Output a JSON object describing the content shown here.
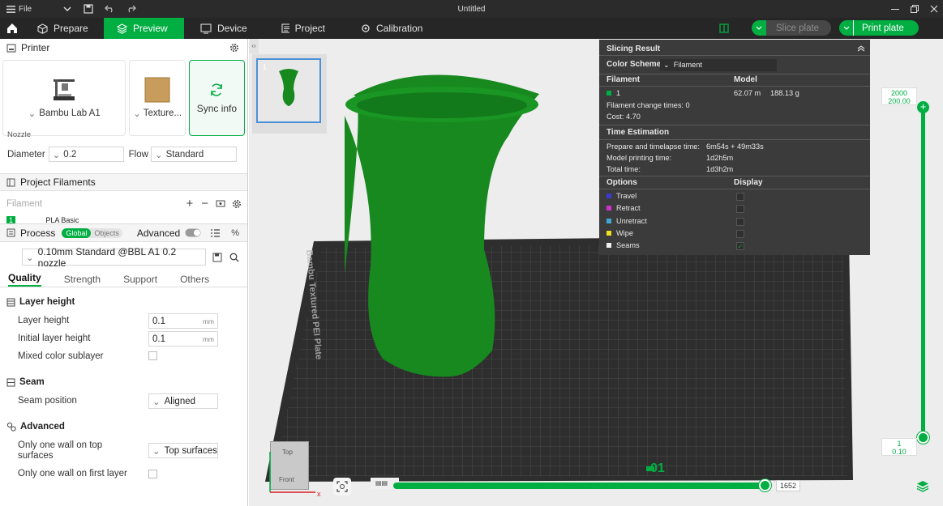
{
  "titlebar": {
    "file_label": "File",
    "title": "Untitled"
  },
  "tabs": [
    {
      "label": "Prepare",
      "icon": "cube-icon"
    },
    {
      "label": "Preview",
      "icon": "layers-icon",
      "active": true
    },
    {
      "label": "Device",
      "icon": "device-icon"
    },
    {
      "label": "Project",
      "icon": "project-icon"
    },
    {
      "label": "Calibration",
      "icon": "calibration-icon"
    }
  ],
  "actions": {
    "slice_label": "Slice plate",
    "print_label": "Print plate"
  },
  "printer": {
    "section_title": "Printer",
    "printer_name": "Bambu Lab A1",
    "plate_type": "Texture...",
    "sync_label": "Sync info",
    "nozzle_label": "Nozzle",
    "diameter_label": "Diameter",
    "diameter_value": "0.2",
    "flow_label": "Flow",
    "flow_value": "Standard"
  },
  "filaments": {
    "section_title": "Project Filaments",
    "placeholder": "Filament",
    "first_item": "PLA Basic",
    "first_index": "1"
  },
  "process": {
    "section_title": "Process",
    "global_label": "Global",
    "objects_label": "Objects",
    "advanced_label": "Advanced",
    "preset": "0.10mm Standard @BBL A1 0.2 nozzle",
    "subtabs": [
      "Quality",
      "Strength",
      "Support",
      "Others"
    ],
    "layer_height_group": "Layer height",
    "layer_height_label": "Layer height",
    "layer_height_value": "0.1",
    "initial_layer_label": "Initial layer height",
    "initial_layer_value": "0.1",
    "unit_mm": "mm",
    "mixed_color_label": "Mixed color sublayer",
    "seam_group": "Seam",
    "seam_position_label": "Seam position",
    "seam_position_value": "Aligned",
    "advanced_group": "Advanced",
    "one_wall_top_label_1": "Only one wall on top",
    "one_wall_top_label_2": "surfaces",
    "one_wall_top_value": "Top surfaces",
    "one_wall_first_label": "Only one wall on first layer"
  },
  "plate_thumb": {
    "number": "1"
  },
  "bed": {
    "label": "Bambu Textured PEI Plate",
    "plate_number": "01"
  },
  "view_cube": {
    "top": "Top",
    "front": "Front",
    "axis_x": "x"
  },
  "slicing_result": {
    "title": "Slicing Result",
    "color_scheme_label": "Color Scheme",
    "color_scheme_value": "Filament",
    "col_filament": "Filament",
    "col_model": "Model",
    "filament_index": "1",
    "filament_length": "62.07 m",
    "filament_weight": "188.13 g",
    "change_times": "Filament change times:  0",
    "cost": "Cost:  4.70",
    "time_title": "Time Estimation",
    "prepare_label": "Prepare and timelapse time:",
    "prepare_value": "6m54s + 49m33s",
    "model_time_label": "Model printing time:",
    "model_time_value": "1d2h5m",
    "total_label": "Total time:",
    "total_value": "1d3h2m",
    "options_label": "Options",
    "display_label": "Display",
    "options": [
      {
        "label": "Travel",
        "color": "#3a3ad0",
        "checked": false
      },
      {
        "label": "Retract",
        "color": "#d030d0",
        "checked": false
      },
      {
        "label": "Unretract",
        "color": "#40a8d8",
        "checked": false
      },
      {
        "label": "Wipe",
        "color": "#f0e020",
        "checked": false
      },
      {
        "label": "Seams",
        "color": "#f0f0f0",
        "checked": true
      }
    ]
  },
  "vertical_slider": {
    "top_layer": "2000",
    "top_height": "200.00",
    "bottom_layer": "1",
    "bottom_height": "0.10"
  },
  "horizontal_slider": {
    "value": "1652"
  },
  "colors": {
    "accent": "#00ae42",
    "model": "#17891f"
  }
}
